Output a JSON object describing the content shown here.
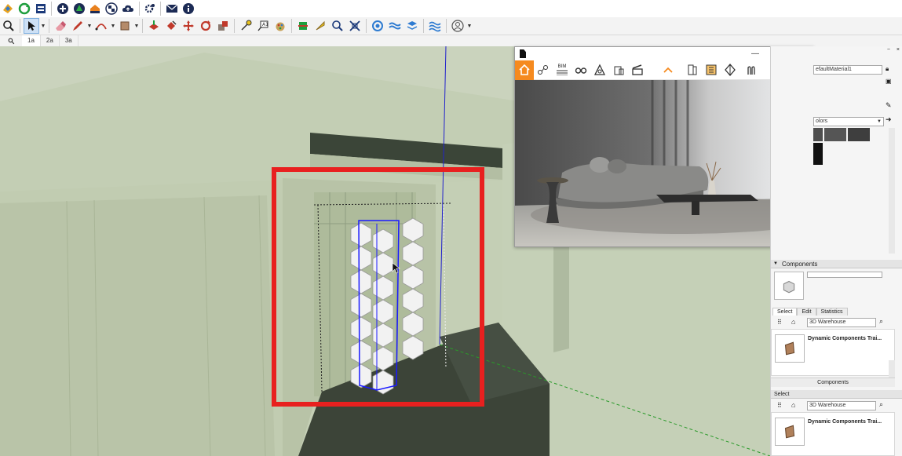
{
  "toolbar": {
    "row1_icons": [
      "sketchup-logo-icon",
      "sync-icon",
      "layout-icon",
      "add-icon",
      "tree-icon",
      "shelf-icon",
      "checker-icon",
      "cloud-icon",
      "settings-icon",
      "mail-icon",
      "info-icon"
    ],
    "row2_icons": [
      "zoom-icon",
      "select-icon",
      "eraser-icon",
      "pencil-icon",
      "arc-icon",
      "shape-icon",
      "paint-bucket-icon",
      "push-pull-icon",
      "move-icon",
      "rotate-icon",
      "scale-icon",
      "tape-measure-icon",
      "text-icon",
      "paint-icon",
      "section-icon",
      "walk-icon",
      "zoom-extents-icon",
      "orbit-icon",
      "pan-icon",
      "zoom-window-icon",
      "layer-icon",
      "layers-icon",
      "profile-icon"
    ],
    "scene_tabs": [
      "1a",
      "2a",
      "3a"
    ]
  },
  "render_window": {
    "controls": [
      "—",
      "☐",
      "✕"
    ],
    "tools": [
      "home-icon",
      "paths-icon",
      "bim-icon",
      "glasses-icon",
      "lamp-icon",
      "building-icon",
      "clapper-icon",
      "caret-up-icon",
      "door-icon",
      "frame-icon",
      "sphere-icon",
      "camera-icon",
      "bulb-icon",
      "eye-icon"
    ],
    "bim_label": "BIM"
  },
  "tray": {
    "materials": {
      "material_name": "efaultMaterial1",
      "library": "olors"
    },
    "components": {
      "title": "Components",
      "tabs": [
        "Select",
        "Edit",
        "Statistics"
      ],
      "search_placeholder": "3D Warehouse",
      "result_title": "Dynamic Components Trai...",
      "footer": "Components"
    },
    "select2": {
      "title": "Select",
      "search_placeholder": "3D Warehouse",
      "result_title": "Dynamic Components Trai..."
    }
  },
  "colors": {
    "accent": "#f58a1f",
    "highlight": "#e8201f",
    "selection": "#1a1aff",
    "wall": "#c4cfb5",
    "floor": "#3c4438"
  }
}
